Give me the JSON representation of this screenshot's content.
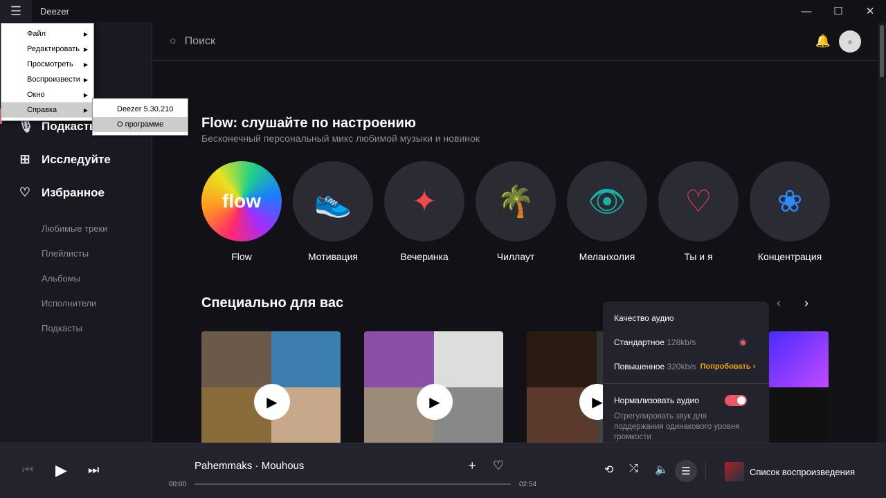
{
  "window": {
    "title": "Deezer",
    "minimize": "—",
    "maximize": "☐",
    "close": "✕"
  },
  "menu": {
    "items": [
      {
        "label": "Файл"
      },
      {
        "label": "Редактировать"
      },
      {
        "label": "Просмотреть"
      },
      {
        "label": "Воспроизвести"
      },
      {
        "label": "Окно"
      },
      {
        "label": "Справка"
      }
    ],
    "submenu": [
      {
        "label": "Deezer 5.30.210"
      },
      {
        "label": "О программе"
      }
    ]
  },
  "sidebar": {
    "main": [
      {
        "label": "Подкасты",
        "icon": "🎙"
      },
      {
        "label": "Исследуйте",
        "icon": "⊞"
      },
      {
        "label": "Избранное",
        "icon": "♡"
      }
    ],
    "sub": [
      "Любимые треки",
      "Плейлисты",
      "Альбомы",
      "Исполнители",
      "Подкасты"
    ]
  },
  "search": {
    "placeholder": "Поиск"
  },
  "flow": {
    "title": "Flow: слушайте по настроению",
    "subtitle": "Бесконечный персональный микс любимой музыки и новинок",
    "logo": "flow",
    "items": [
      {
        "label": "Flow",
        "icon": "",
        "color": "#fff"
      },
      {
        "label": "Мотивация",
        "icon": "👟",
        "color": "#f08a24"
      },
      {
        "label": "Вечеринка",
        "icon": "✦",
        "color": "#ef4a4a"
      },
      {
        "label": "Чиллаут",
        "icon": "🌴",
        "color": "#c23ac8"
      },
      {
        "label": "Меланхолия",
        "icon": "👁",
        "color": "#19b3a6"
      },
      {
        "label": "Ты и я",
        "icon": "♡",
        "color": "#ef3a55"
      },
      {
        "label": "Концентрация",
        "icon": "❀",
        "color": "#2a8cff"
      }
    ]
  },
  "special": {
    "title": "Специально для вас"
  },
  "audio": {
    "title": "Качество аудио",
    "standard": "Стандартное",
    "standard_rate": "128kb/s",
    "high": "Повышенное",
    "high_rate": "320kb/s",
    "try": "Попробовать ›",
    "normalize": "Нормализовать аудио",
    "normalize_on": true,
    "normalize_desc": "Отрегулировать звук для поддержания одинакового уровня громкости"
  },
  "player": {
    "track": "Pahemmaks · Mouhous",
    "elapsed": "00:00",
    "duration": "02:54",
    "progress": 0,
    "queue": "Список воспроизведения"
  }
}
